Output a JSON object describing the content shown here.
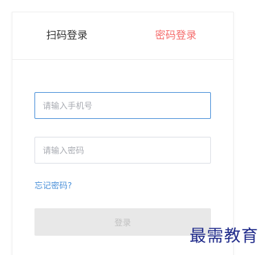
{
  "login": {
    "tabs": {
      "qr_login": "扫码登录",
      "password_login": "密码登录",
      "active": "password_login"
    },
    "phone_input": {
      "value": "",
      "placeholder": "请输入手机号"
    },
    "password_input": {
      "value": "",
      "placeholder": "请输入密码"
    },
    "forgot_password": "忘记密码?",
    "submit_label": "登录"
  },
  "watermark": {
    "text": "最需教育"
  },
  "colors": {
    "active_tab": "#f56c6c",
    "inactive_tab": "#333333",
    "link": "#4a90d9",
    "focused_border": "#4a90d9",
    "button_disabled_bg": "#e8e8e8",
    "button_disabled_text": "#c0c0c0",
    "watermark": "#1f2a8a"
  }
}
